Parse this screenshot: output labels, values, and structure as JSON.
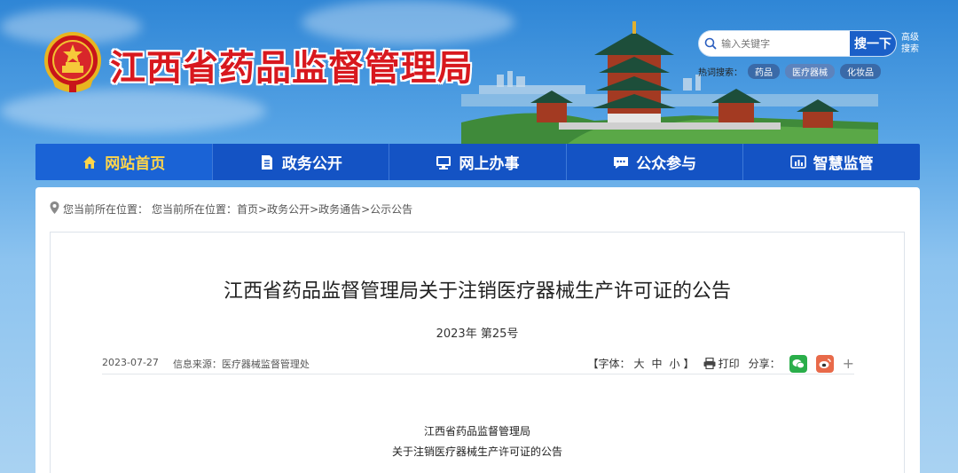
{
  "header": {
    "site_title": "江西省药品监督管理局",
    "search": {
      "placeholder": "输入关键字",
      "button": "搜一下"
    },
    "advanced_search": "高级搜索",
    "hot_label": "热词搜索：",
    "hot_words": [
      "药品",
      "医疗器械",
      "化妆品"
    ]
  },
  "nav": {
    "items": [
      {
        "label": "网站首页",
        "icon": "home-icon"
      },
      {
        "label": "政务公开",
        "icon": "document-icon"
      },
      {
        "label": "网上办事",
        "icon": "monitor-icon"
      },
      {
        "label": "公众参与",
        "icon": "chat-icon"
      },
      {
        "label": "智慧监管",
        "icon": "chart-icon"
      }
    ]
  },
  "breadcrumb": {
    "prefix": "您当前所在位置：",
    "path": "您当前所在位置：首页>政务公开>政务通告>公示公告"
  },
  "article": {
    "title": "江西省药品监督管理局关于注销医疗器械生产许可证的公告",
    "doc_no": "2023年 第25号",
    "date": "2023-07-27",
    "source": "信息来源：医疗器械监督管理处",
    "font_label": "【字体：",
    "font_sizes": [
      "大",
      "中",
      "小"
    ],
    "font_close": "】",
    "print": "打印",
    "share": "分享：",
    "plus": "+",
    "body_line1": "江西省药品监督管理局",
    "body_line2": "关于注销医疗器械生产许可证的公告"
  },
  "colors": {
    "title_red": "#d8181e",
    "nav_blue": "#1453c4",
    "nav_active_text": "#ffd54a"
  }
}
